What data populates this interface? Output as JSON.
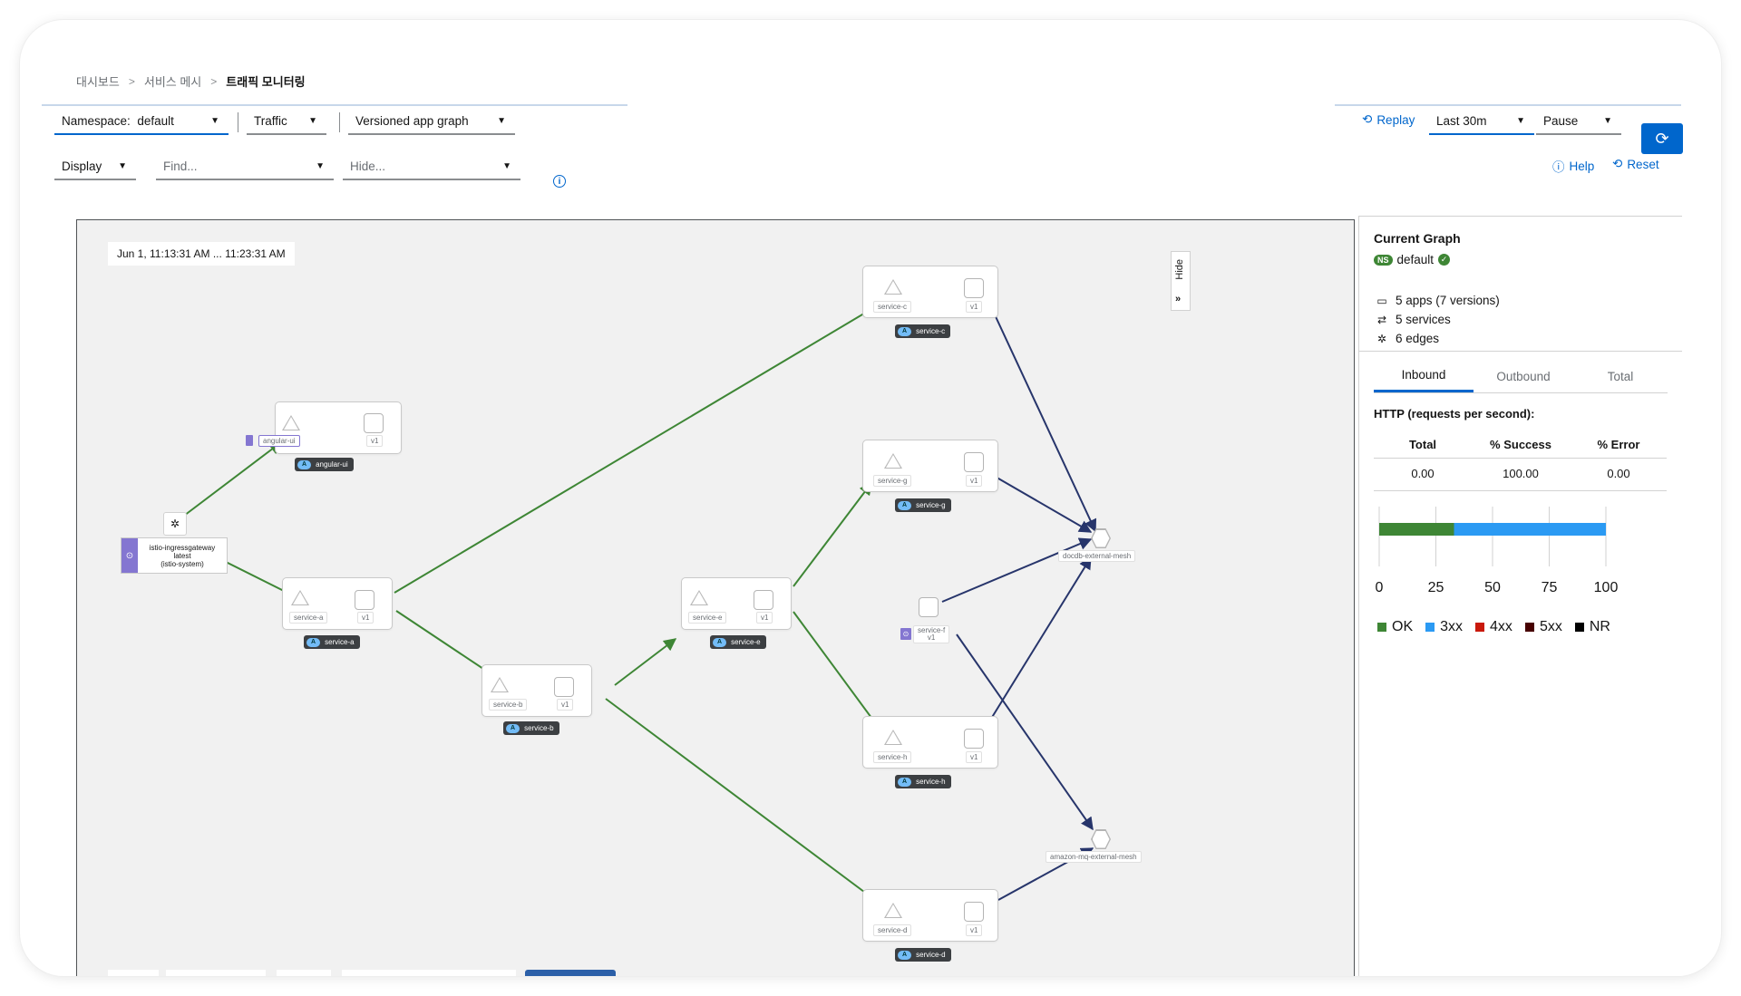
{
  "breadcrumb": {
    "items": [
      "대시보드",
      "서비스 메시"
    ],
    "current": "트래픽 모니터링",
    "separator": ">"
  },
  "toolbar": {
    "namespace_label": "Namespace:",
    "namespace_value": "default",
    "traffic": "Traffic",
    "graph_type": "Versioned app graph",
    "display": "Display",
    "find_placeholder": "Find...",
    "hide_placeholder": "Hide...",
    "replay": "Replay",
    "interval": "Last 30m",
    "refresh": "Pause",
    "help": "Help",
    "reset": "Reset"
  },
  "graph": {
    "time_range": "Jun 1, 11:13:31 AM ... 11:23:31 AM",
    "hide_tab": "Hide",
    "gateway": {
      "line1": "istio-ingressgateway",
      "line2": "latest",
      "line3": "(istio-system)"
    },
    "nodes": {
      "angular_ui": {
        "label": "angular-ui",
        "version": "v1",
        "app": "angular-ui"
      },
      "service_a": {
        "label": "service-a",
        "version": "v1",
        "app": "service-a"
      },
      "service_b": {
        "label": "service-b",
        "version": "v1",
        "app": "service-b"
      },
      "service_c": {
        "label": "service-c",
        "version": "v1",
        "app": "service-c"
      },
      "service_d": {
        "label": "service-d",
        "version": "v1",
        "app": "service-d"
      },
      "service_e": {
        "label": "service-e",
        "version": "v1",
        "app": "service-e"
      },
      "service_g": {
        "label": "service-g",
        "version": "v1",
        "app": "service-g"
      },
      "service_h": {
        "label": "service-h",
        "version": "v1",
        "app": "service-h"
      },
      "service_f": {
        "label": "service-f",
        "version": "v1"
      },
      "docdb": {
        "label": "docdb-external-mesh"
      },
      "amazonmq": {
        "label": "amazon-mq-external-mesh"
      }
    },
    "app_badge": "A"
  },
  "sidebar": {
    "title": "Current Graph",
    "ns_badge": "NS",
    "namespace": "default",
    "apps": "5 apps (7 versions)",
    "services": "5 services",
    "edges": "6 edges",
    "tabs": [
      "Inbound",
      "Outbound",
      "Total"
    ],
    "http_title": "HTTP (requests per second):",
    "table_headers": [
      "Total",
      "% Success",
      "% Error"
    ],
    "table_values": [
      "0.00",
      "100.00",
      "0.00"
    ],
    "legend": [
      {
        "name": "OK",
        "color": "#3e8635"
      },
      {
        "name": "3xx",
        "color": "#2b9af3"
      },
      {
        "name": "4xx",
        "color": "#c9190b"
      },
      {
        "name": "5xx",
        "color": "#470000"
      },
      {
        "name": "NR",
        "color": "#000000"
      }
    ]
  },
  "chart_data": {
    "type": "bar",
    "orientation": "horizontal",
    "stacked": true,
    "xlim": [
      0,
      100
    ],
    "ticks": [
      "0",
      "25",
      "50",
      "75",
      "100"
    ],
    "series": [
      {
        "name": "OK",
        "values": [
          33
        ]
      },
      {
        "name": "3xx",
        "values": [
          67
        ]
      }
    ]
  }
}
